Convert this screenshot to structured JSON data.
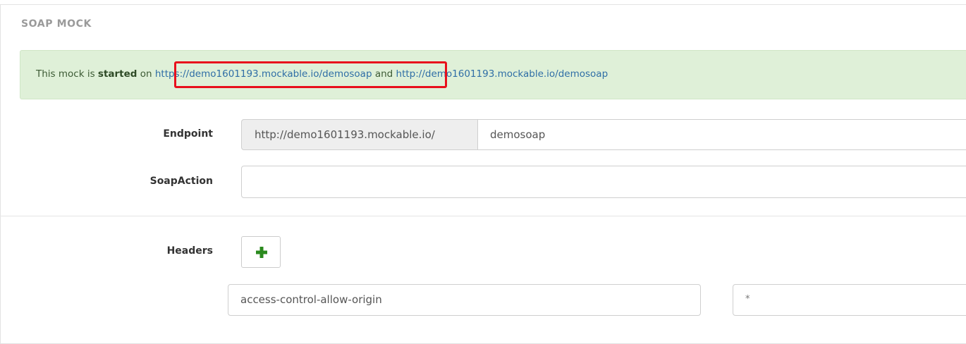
{
  "section": {
    "title": "SOAP MOCK"
  },
  "alert": {
    "prefix": "This mock is ",
    "status": "started",
    "on_text": " on ",
    "https_url": "https://demo1601193.mockable.io/demosoap",
    "and_text": " and ",
    "http_url": "http://demo1601193.mockable.io/demosoap"
  },
  "endpoint": {
    "label": "Endpoint",
    "base_url": "http://demo1601193.mockable.io/",
    "path_value": "demosoap"
  },
  "soap_action": {
    "label": "SoapAction",
    "value": ""
  },
  "headers": {
    "label": "Headers",
    "add_icon": "plus-icon",
    "rows": [
      {
        "name": "access-control-allow-origin",
        "value": "*"
      }
    ]
  },
  "colors": {
    "alert_bg": "#dff0d8",
    "link": "#2f6ea6",
    "highlight": "#e8101c",
    "add_icon": "#2b8a1e"
  }
}
